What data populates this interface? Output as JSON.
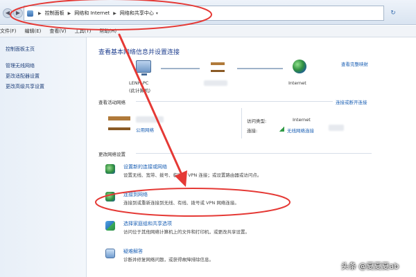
{
  "address_bar": {
    "back": "◀",
    "forward": "▶",
    "crumbs": [
      "控制面板",
      "网络和 Internet",
      "网络和共享中心"
    ],
    "dropdown": "▾",
    "refresh": "↻"
  },
  "menu": [
    "文件(F)",
    "编辑(E)",
    "查看(V)",
    "工具(T)",
    "帮助(H)"
  ],
  "sidebar": {
    "home": "控制面板主页",
    "items": [
      "管理无线网络",
      "更改适配器设置",
      "更改高级共享设置"
    ]
  },
  "main": {
    "title": "查看基本网络信息并设置连接",
    "full_map_link": "查看完整映射",
    "map": {
      "pc_name": "LENH-PC",
      "pc_sub": "(此计算机)",
      "internet": "Internet"
    },
    "active_label": "查看活动网络",
    "connect_disconnect": "连接或断开连接",
    "network": {
      "type": "公用网络",
      "access_type_label": "访问类型:",
      "access_type_value": "Internet",
      "connection_label": "连接:",
      "connection_value": "无线网络连接"
    },
    "change_label": "更改网络设置",
    "tasks": [
      {
        "title": "设置新的连接或网络",
        "desc": "设置无线、宽带、拨号、临时或 VPN 连接；或设置路由器或访问点。"
      },
      {
        "title": "连接到网络",
        "desc": "连接到或重新连接到无线、有线、拨号或 VPN 网络连接。"
      },
      {
        "title": "选择家庭组和共享选项",
        "desc": "访问位于其他网络计算机上的文件和打印机，或更改共享设置。"
      },
      {
        "title": "疑难解答",
        "desc": "诊断并修复网络问题，或获得故障排除信息。"
      }
    ]
  },
  "watermark": "头条 @夏夏夏ab",
  "colors": {
    "link": "#1a5fb4",
    "annotation": "#e53935",
    "title": "#1f3f8f"
  }
}
